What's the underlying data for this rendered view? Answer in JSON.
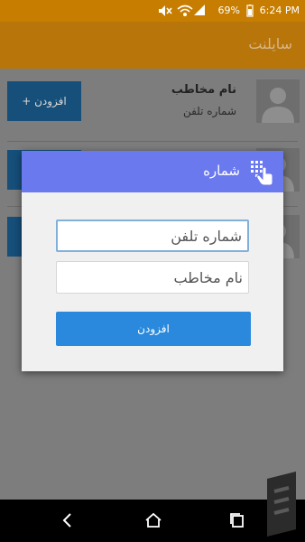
{
  "status_bar": {
    "battery": "69%",
    "time": "6:24 PM"
  },
  "app_bar": {
    "title": "سایلنت"
  },
  "contacts": [
    {
      "name": "نام مخاطب",
      "phone": "شماره تلفن",
      "add_label": "+ افزودن"
    },
    {
      "name": "",
      "phone": "",
      "add_label": ""
    },
    {
      "name": "",
      "phone": "",
      "add_label": ""
    }
  ],
  "dialog": {
    "title": "شماره",
    "phone_placeholder": "شماره تلفن",
    "name_placeholder": "نام مخاطب",
    "add_label": "افزودن"
  },
  "icons": {
    "dialog_icon": "touch-dialpad-icon",
    "nav_back": "back-icon",
    "nav_home": "home-icon",
    "nav_recent": "recent-apps-icon"
  },
  "colors": {
    "app_bar": "#b8750a",
    "dialog_header": "#6b79ef",
    "primary_button": "#2a89dc"
  }
}
